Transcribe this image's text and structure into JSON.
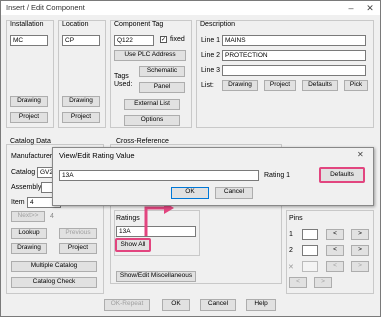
{
  "window": {
    "title": "Insert / Edit Component",
    "minimize_glyph": "–",
    "close_glyph": "✕"
  },
  "installation": {
    "label": "Installation",
    "value": "MC",
    "drawing_btn": "Drawing",
    "project_btn": "Project"
  },
  "location": {
    "label": "Location",
    "value": "CP",
    "drawing_btn": "Drawing",
    "project_btn": "Project"
  },
  "component_tag": {
    "label": "Component Tag",
    "value": "Q122",
    "fixed_label": "fixed",
    "fixed_checked": "✓",
    "use_plc": "Use PLC Address",
    "tags_used": "Tags Used:",
    "schematic": "Schematic",
    "panel": "Panel",
    "external_list": "External List",
    "options": "Options"
  },
  "description": {
    "label": "Description",
    "line1_label": "Line 1",
    "line1": "MAINS",
    "line2_label": "Line 2",
    "line2": "PROTECTION",
    "line3_label": "Line 3",
    "line3": "",
    "list_label": "List:",
    "drawing": "Drawing",
    "project": "Project",
    "defaults": "Defaults",
    "pick": "Pick"
  },
  "catalog": {
    "label": "Catalog Data",
    "manufacturer_label": "Manufacturer",
    "catalog_label": "Catalog",
    "catalog_value": "GV2M",
    "assembly_label": "Assembly",
    "item_label": "Item",
    "item_value": "4",
    "next": "Next>>",
    "next_count": "4",
    "lookup": "Lookup",
    "previous": "Previous",
    "drawing": "Drawing",
    "project": "Project",
    "multiple_catalog": "Multiple Catalog",
    "catalog_check": "Catalog Check"
  },
  "cross_ref": {
    "label": "Cross-Reference"
  },
  "ratings": {
    "label": "Ratings",
    "value": "13A",
    "show_all": "Show All",
    "show_edit_misc": "Show/Edit Miscellaneous"
  },
  "pins": {
    "label": "Pins",
    "pin1": "1",
    "pin2": "2",
    "pin_x": "✕",
    "prev": "<",
    "next": ">"
  },
  "bottom": {
    "ok_repeat": "OK-Repeat",
    "ok": "OK",
    "cancel": "Cancel",
    "help": "Help"
  },
  "dialog": {
    "title": "View/Edit Rating Value",
    "value": "13A",
    "rating_label": "Rating 1",
    "defaults": "Defaults",
    "ok": "OK",
    "cancel": "Cancel",
    "close_glyph": "✕"
  },
  "annotation": {
    "highlight_color": "#e2457f"
  }
}
